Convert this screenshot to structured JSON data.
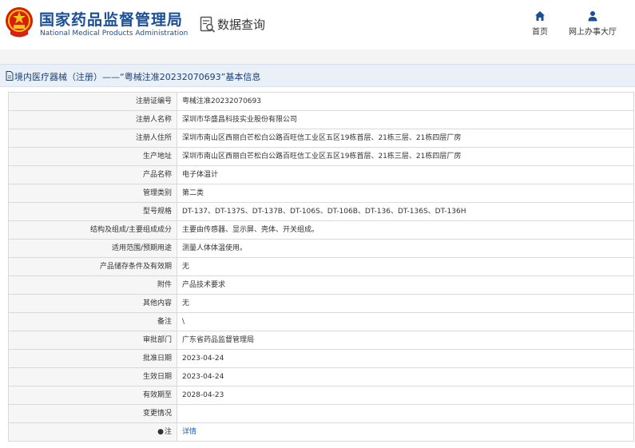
{
  "header": {
    "org_cn": "国家药品监督管理局",
    "org_en": "National Medical Products Administration",
    "query_title": "数据查询",
    "nav": [
      {
        "label": "首页",
        "icon": "home-icon"
      },
      {
        "label": "网上办事大厅",
        "icon": "user-icon"
      }
    ]
  },
  "titlebar": {
    "text": "境内医疗器械（注册）——“粤械注准20232070693”基本信息"
  },
  "details": {
    "rows": [
      {
        "key": "注册证编号",
        "value": "粤械注准20232070693"
      },
      {
        "key": "注册人名称",
        "value": "深圳市华盛昌科技实业股份有限公司"
      },
      {
        "key": "注册人住所",
        "value": "深圳市南山区西丽白芒松白公路百旺信工业区五区19栋首层、21栋三层、21栋四层厂房"
      },
      {
        "key": "生产地址",
        "value": "深圳市南山区西丽白芒松白公路百旺信工业区五区19栋首层、21栋三层、21栋四层厂房"
      },
      {
        "key": "产品名称",
        "value": "电子体温计"
      },
      {
        "key": "管理类别",
        "value": "第二类"
      },
      {
        "key": "型号规格",
        "value": "DT-137、DT-137S、DT-137B、DT-106S、DT-106B、DT-136、DT-136S、DT-136H"
      },
      {
        "key": "结构及组成/主要组成成分",
        "value": "主要由传感器、显示屏、壳体、开关组成。"
      },
      {
        "key": "适用范围/预期用途",
        "value": "测量人体体温使用。"
      },
      {
        "key": "产品储存条件及有效期",
        "value": "无"
      },
      {
        "key": "附件",
        "value": "产品技术要求"
      },
      {
        "key": "其他内容",
        "value": "无"
      },
      {
        "key": "备注",
        "value": "\\"
      },
      {
        "key": "审批部门",
        "value": "广东省药品监督管理局"
      },
      {
        "key": "批准日期",
        "value": "2023-04-24"
      },
      {
        "key": "生效日期",
        "value": "2023-04-24"
      },
      {
        "key": "有效期至",
        "value": "2028-04-23"
      },
      {
        "key": "变更情况",
        "value": ""
      },
      {
        "key": "注",
        "value": "详情"
      }
    ]
  },
  "colors": {
    "brand_blue": "#1a4f97",
    "titlebar_bg": "#eaf0f8",
    "link_blue": "#1f5fb0",
    "emblem_red": "#d81e06",
    "emblem_gold": "#f5c518"
  }
}
